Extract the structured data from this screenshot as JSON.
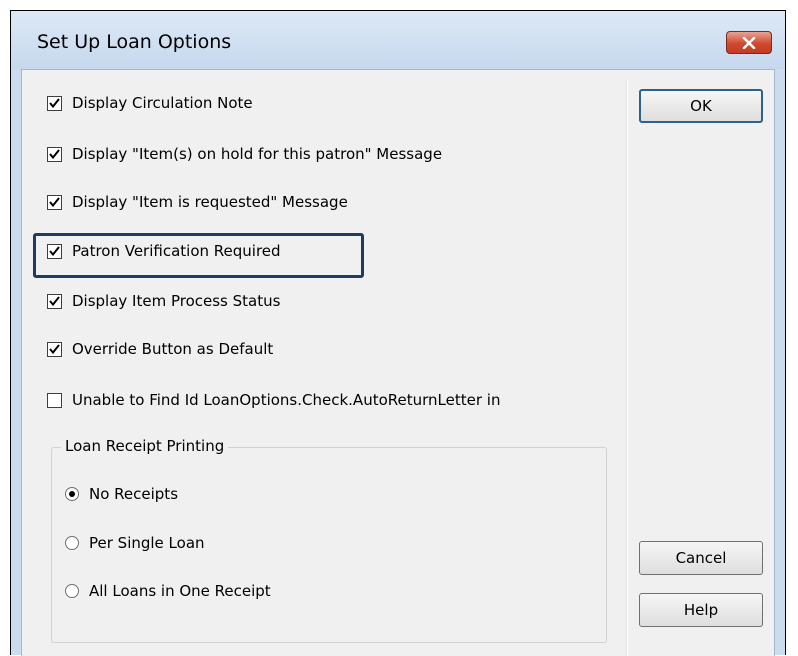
{
  "dialog": {
    "title": "Set Up Loan Options"
  },
  "checkboxes": [
    {
      "label": "Display Circulation Note",
      "checked": true
    },
    {
      "label": "Display \"Item(s) on hold for this patron\" Message",
      "checked": true
    },
    {
      "label": "Display \"Item is requested\" Message",
      "checked": true
    },
    {
      "label": "Patron Verification Required",
      "checked": true
    },
    {
      "label": "Display Item Process Status",
      "checked": true
    },
    {
      "label": "Override Button as Default",
      "checked": true
    },
    {
      "label": "Unable to Find Id LoanOptions.Check.AutoReturnLetter in",
      "checked": false
    }
  ],
  "receipt_group": {
    "label": "Loan Receipt Printing",
    "options": [
      {
        "label": "No Receipts",
        "selected": true
      },
      {
        "label": "Per Single Loan",
        "selected": false
      },
      {
        "label": "All Loans in One Receipt",
        "selected": false
      }
    ]
  },
  "buttons": {
    "ok": "OK",
    "cancel": "Cancel",
    "help": "Help"
  },
  "icons": {
    "close": "close-icon",
    "check": "checkmark-icon"
  },
  "colors": {
    "highlight": "#1e3c60",
    "close_button": "#cf4a30",
    "titlebar": "#c6d8ee"
  }
}
